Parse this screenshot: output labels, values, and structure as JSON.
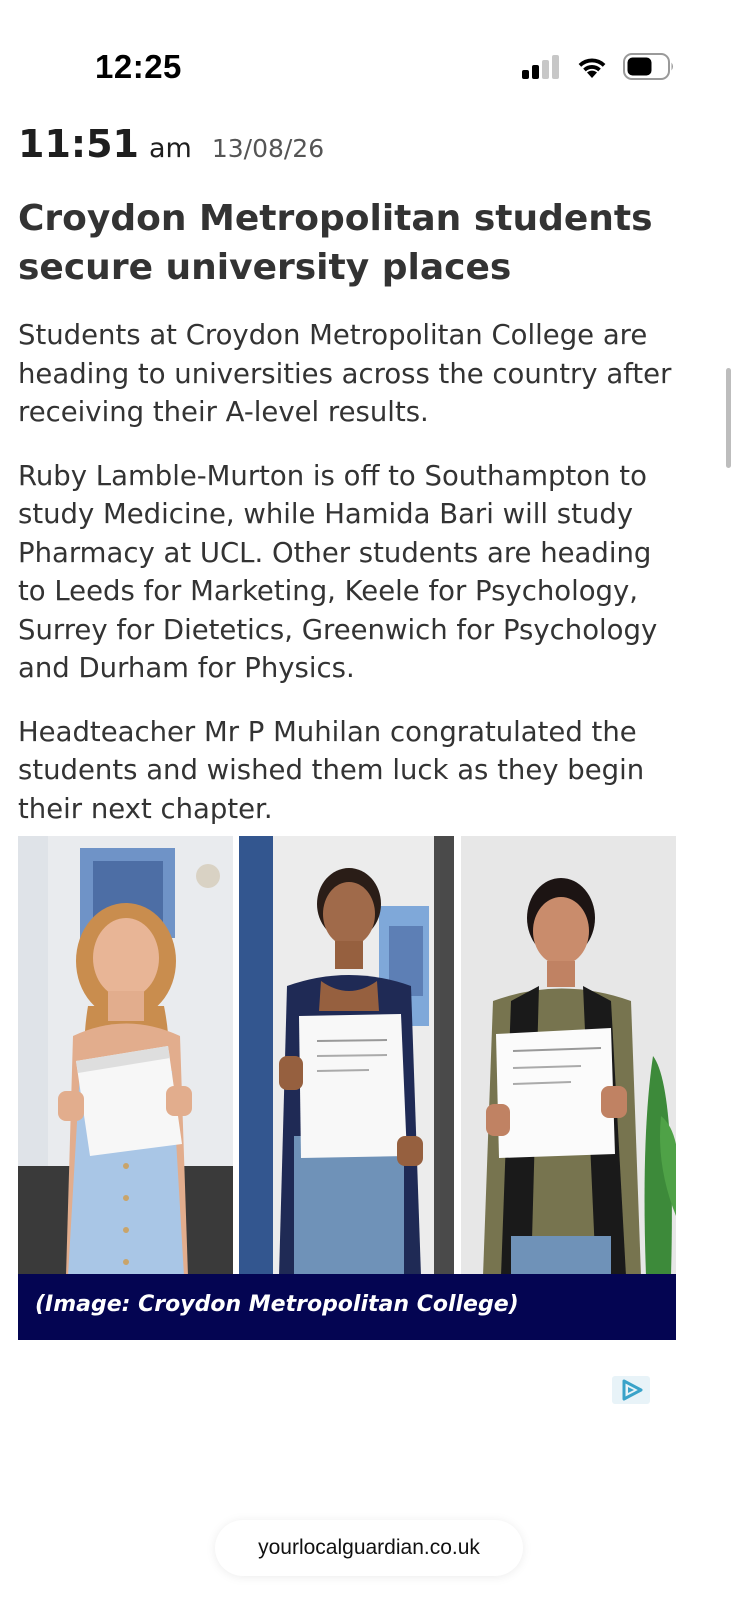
{
  "status_bar": {
    "time": "12:25",
    "icons": [
      "cellular-signal-icon",
      "wifi-icon",
      "battery-icon"
    ]
  },
  "article": {
    "time": "11:51",
    "ampm": "am",
    "date": "13/08/26",
    "headline": "Croydon Metropolitan students secure university places",
    "paragraphs": [
      "Students at Croydon Metropolitan College are heading to universities across the country after receiving their A-level results.",
      "Ruby Lamble-Murton is off to Southampton to study Medicine, while Hamida Bari will study Pharmacy at UCL. Other students are heading to Leeds for Marketing, Keele for Psychology, Surrey for Dietetics, Greenwich for Psychology and Durham for Physics.",
      "Headteacher Mr P Muhilan congratulated the students and wished them luck as they begin their next chapter."
    ],
    "image_caption": "(Image: Croydon Metropolitan College)"
  },
  "ad": {
    "icon": "adchoices-icon"
  },
  "browser": {
    "url": "yourlocalguardian.co.uk"
  },
  "colors": {
    "caption_bg": "#040552",
    "text": "#333333",
    "ad_icon": "#3aa3c9"
  }
}
